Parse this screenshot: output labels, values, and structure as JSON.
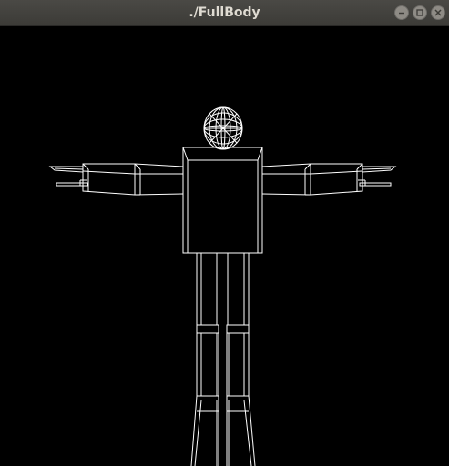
{
  "window": {
    "title": "./FullBody"
  },
  "titlebar_buttons": {
    "minimize_icon": "minimize-icon",
    "maximize_icon": "maximize-icon",
    "close_icon": "close-icon"
  },
  "scene": {
    "background": "#000000",
    "wireframe_color": "#ffffff"
  }
}
